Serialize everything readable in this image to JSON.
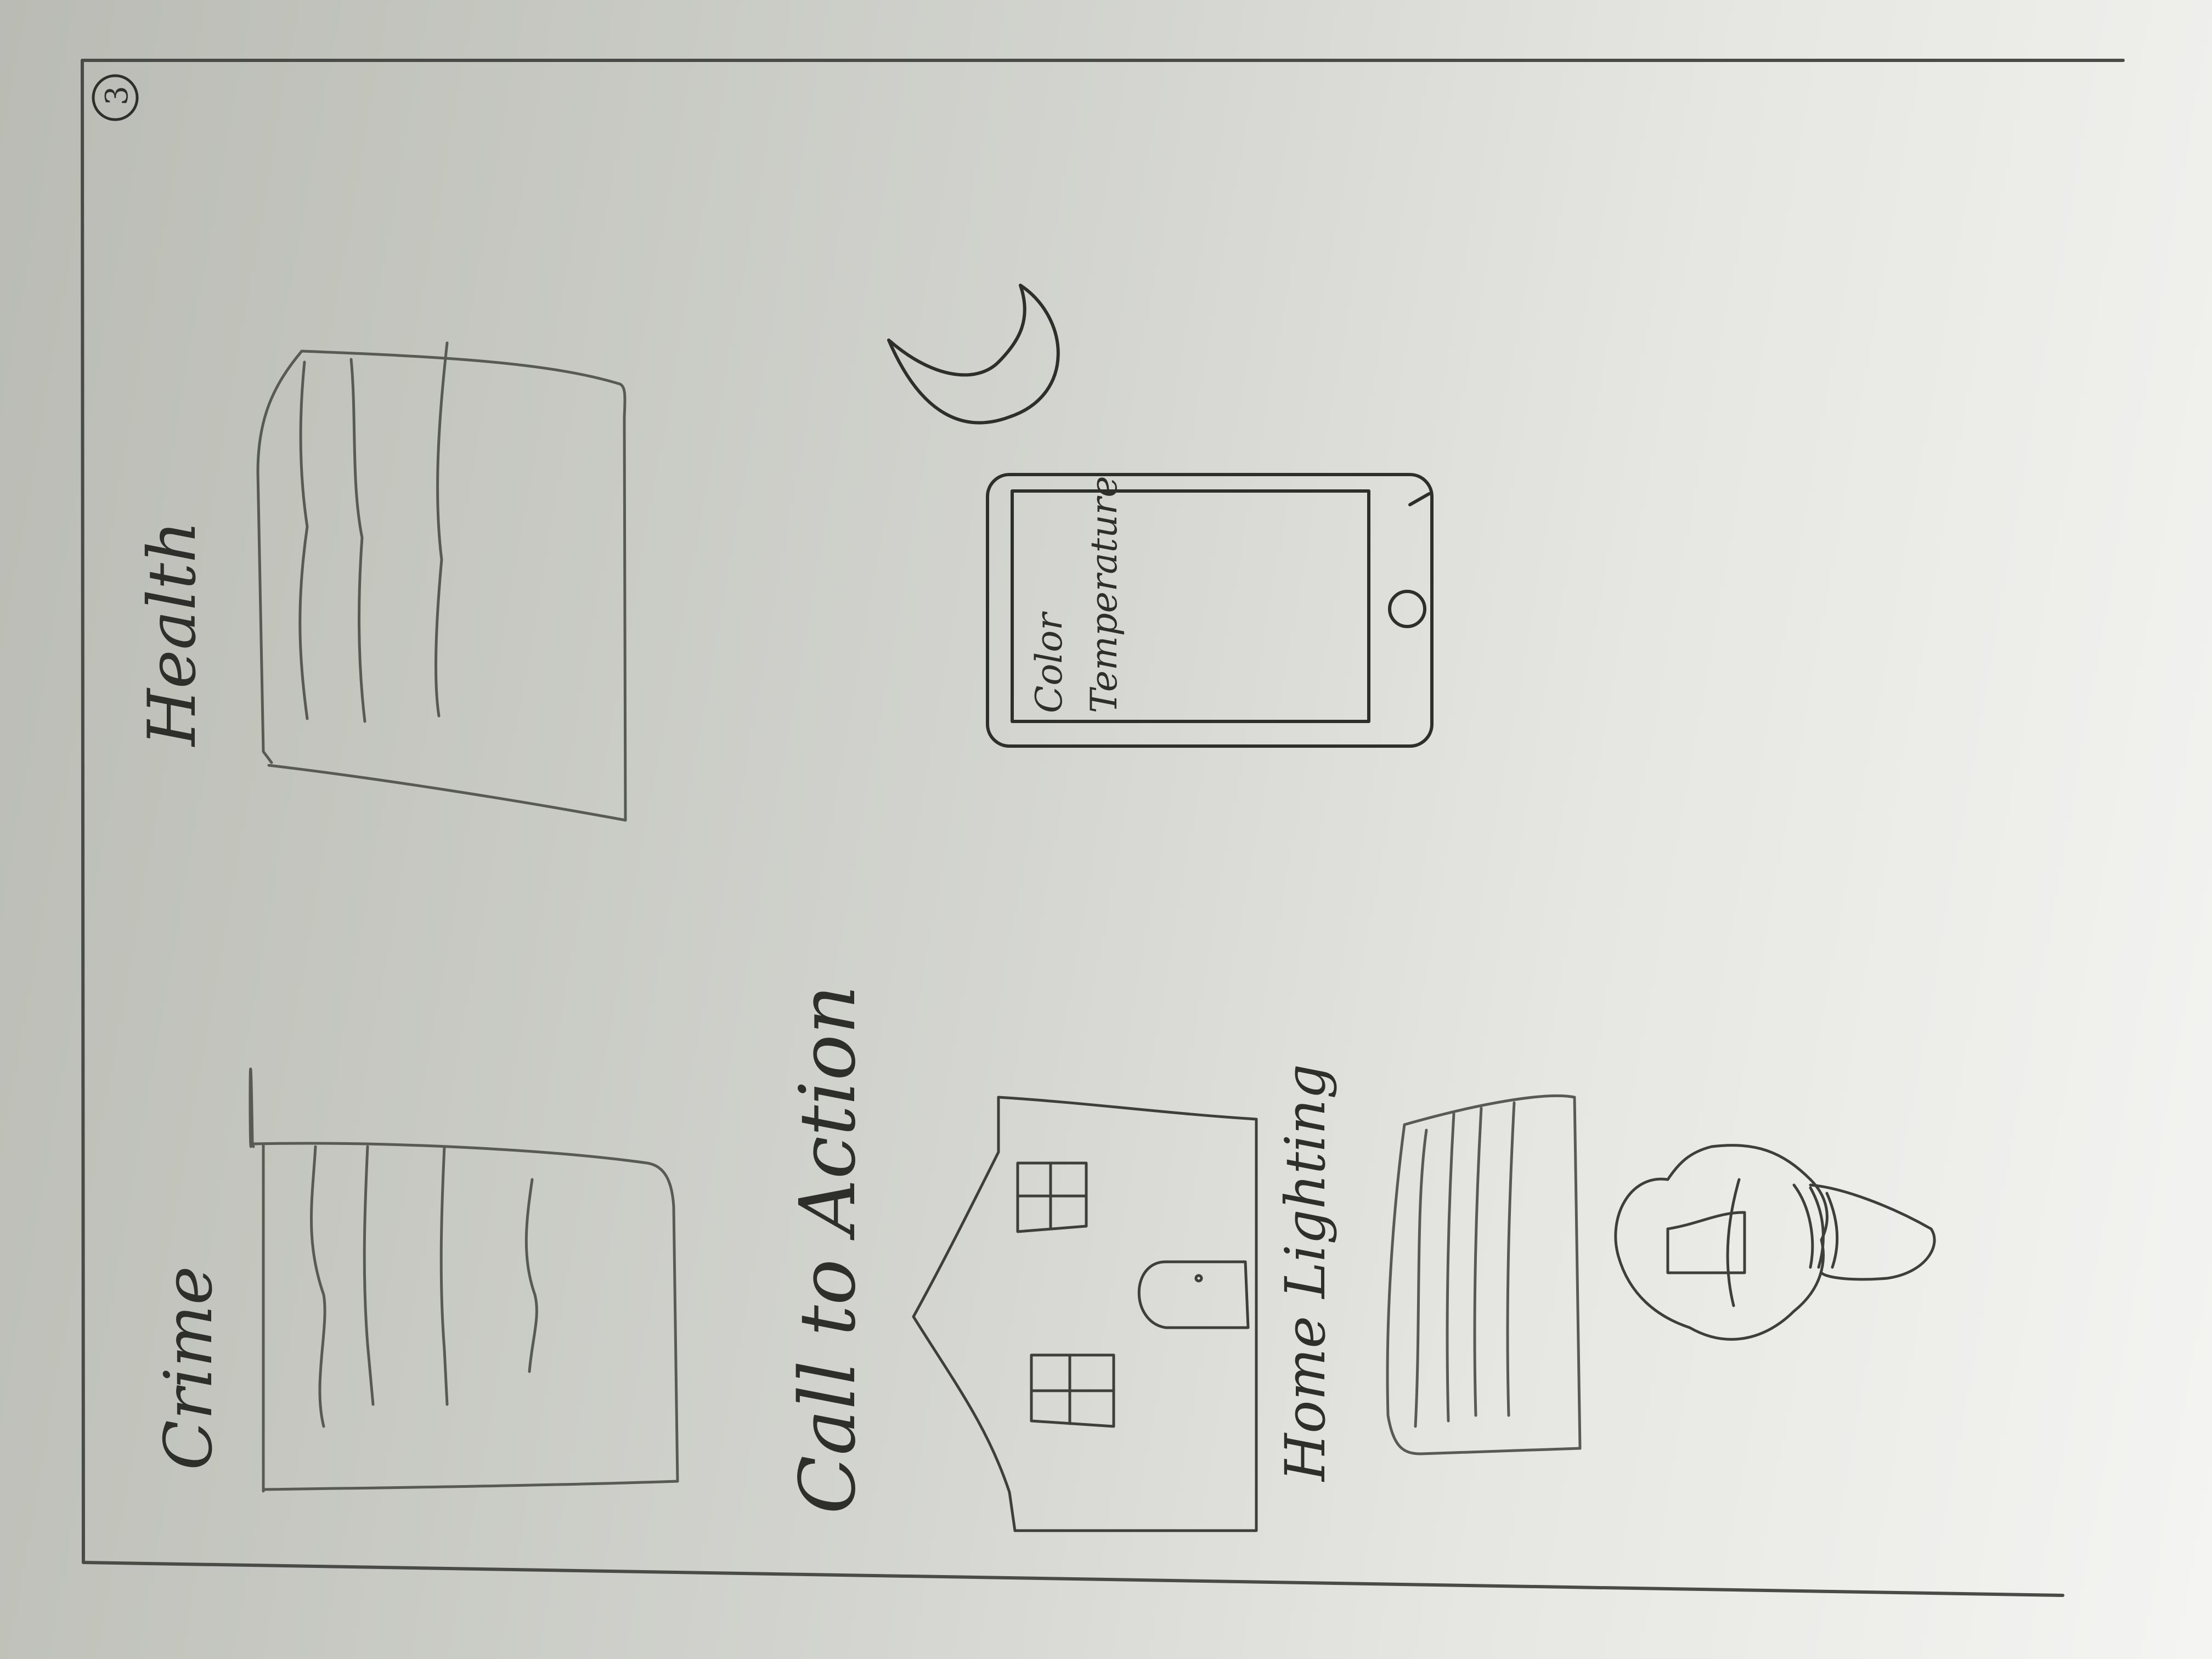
{
  "page_number": "3",
  "sections": {
    "crime": {
      "label": "Crime"
    },
    "health": {
      "label": "Health"
    },
    "call_to_action": {
      "label": "Call to Action"
    }
  },
  "phone": {
    "screen_line1": "Color",
    "screen_line2": "Temperature"
  },
  "home": {
    "label": "Home Lighting"
  },
  "icons": [
    "moon-icon",
    "smartphone-icon",
    "house-icon",
    "light-bulb-icon"
  ],
  "colors": {
    "paper": "#e6e6e2",
    "pencil": "#2e2e2b"
  }
}
